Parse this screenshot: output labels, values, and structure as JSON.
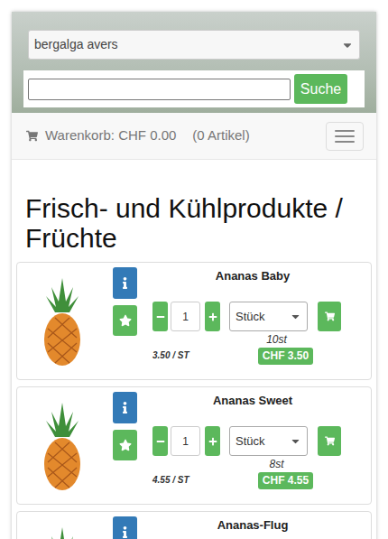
{
  "store_select": {
    "value": "bergalga avers"
  },
  "search": {
    "value": "",
    "button": "Suche"
  },
  "cart": {
    "label": "Warenkorb: CHF 0.00",
    "count": "(0 Artikel)"
  },
  "heading": "Frisch- und Kühlprodukte / Früchte",
  "products": [
    {
      "name": "Ananas Baby",
      "quantity": "1",
      "unit": "Stück",
      "stock": "10st",
      "unit_price": "3.50 / ST",
      "price": "CHF 3.50"
    },
    {
      "name": "Ananas Sweet",
      "quantity": "1",
      "unit": "Stück",
      "stock": "8st",
      "unit_price": "4.55 / ST",
      "price": "CHF 4.55"
    },
    {
      "name": "Ananas-Flug"
    }
  ]
}
